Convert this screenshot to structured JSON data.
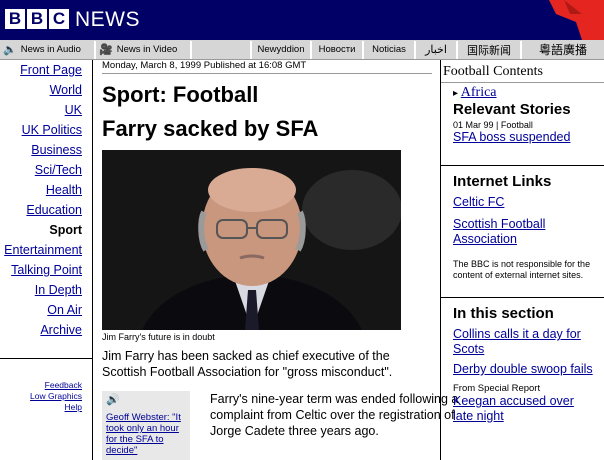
{
  "header": {
    "logo_letters": [
      "B",
      "B",
      "C"
    ],
    "brand": "NEWS"
  },
  "navbar": {
    "audio": "News in Audio",
    "video": "News in Video",
    "welsh": "Newyddion",
    "russian": "Новости",
    "spanish": "Noticias",
    "urdu": "اخبار",
    "chinese_simplified": "国际新闻",
    "chinese_traditional": "粵語廣播"
  },
  "left_nav": {
    "items": [
      "Front Page",
      "World",
      "UK",
      "UK Politics",
      "Business",
      "Sci/Tech",
      "Health",
      "Education",
      "Sport",
      "Entertainment",
      "Talking Point",
      "In Depth",
      "On Air",
      "Archive"
    ],
    "current": "Sport",
    "utils": [
      "Feedback",
      "Low Graphics",
      "Help"
    ]
  },
  "article": {
    "dateline": "Monday, March 8, 1999 Published at 16:08 GMT",
    "section": "Sport: Football",
    "headline": "Farry sacked by SFA",
    "caption": "Jim Farry's future is in doubt",
    "summary": "Jim Farry has been sacked as chief executive of the Scottish Football Association for \"gross misconduct\".",
    "audio_link": "Geoff Webster: \"It took only an hour for the SFA to decide\"",
    "body": "Farry's nine-year term was ended following a complaint from Celtic over the registration of Jorge Cadete three years ago."
  },
  "right": {
    "football_contents": "Football Contents",
    "africa": "Africa",
    "relevant_heading": "Relevant Stories",
    "relevant_date": "01 Mar 99 | Football",
    "relevant_link": "SFA boss suspended",
    "internet_heading": "Internet Links",
    "internet_links": [
      "Celtic FC",
      "Scottish Football Association"
    ],
    "disclaimer": "The BBC is not responsible for the content of external internet sites.",
    "section_heading": "In this section",
    "section_links": [
      "Collins calls it a day for Scots",
      "Derby double swoop fails"
    ],
    "special_report_label": "From Special Report",
    "special_report_link": "Keegan accused over late night"
  }
}
